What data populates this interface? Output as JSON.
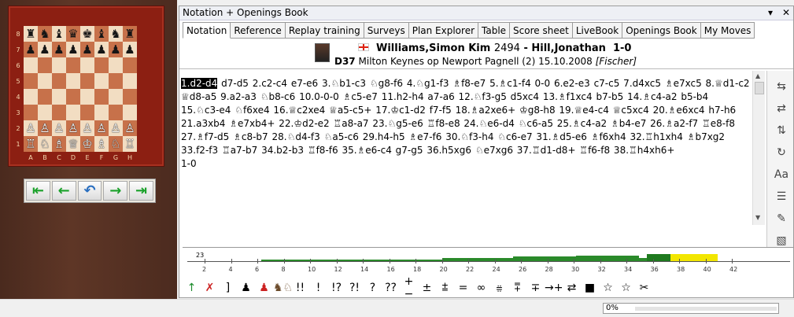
{
  "board": {
    "ranks": [
      "8",
      "7",
      "6",
      "5",
      "4",
      "3",
      "2",
      "1"
    ],
    "files": [
      "A",
      "B",
      "C",
      "D",
      "E",
      "F",
      "G",
      "H"
    ],
    "position": [
      [
        "♜",
        "♞",
        "♝",
        "♛",
        "♚",
        "♝",
        "♞",
        "♜"
      ],
      [
        "♟",
        "♟",
        "♟",
        "♟",
        "♟",
        "♟",
        "♟",
        "♟"
      ],
      [
        "",
        "",
        "",
        "",
        "",
        "",
        "",
        ""
      ],
      [
        "",
        "",
        "",
        "",
        "",
        "",
        "",
        ""
      ],
      [
        "",
        "",
        "",
        "",
        "",
        "",
        "",
        ""
      ],
      [
        "",
        "",
        "",
        "",
        "",
        "",
        "",
        ""
      ],
      [
        "♙",
        "♙",
        "♙",
        "♙",
        "♙",
        "♙",
        "♙",
        "♙"
      ],
      [
        "♖",
        "♘",
        "♗",
        "♕",
        "♔",
        "♗",
        "♘",
        "♖"
      ]
    ]
  },
  "nav": {
    "buttons": [
      "start-icon",
      "back-icon",
      "undo-icon",
      "forward-icon",
      "end-icon"
    ],
    "glyphs": [
      "⇤",
      "←",
      "↶",
      "→",
      "⇥"
    ]
  },
  "window": {
    "title": "Notation + Openings Book",
    "pin": "▾",
    "close": "✕"
  },
  "tabs": [
    "Notation",
    "Reference",
    "Replay training",
    "Surveys",
    "Plan Explorer",
    "Table",
    "Score sheet",
    "LiveBook",
    "Openings Book",
    "My Moves"
  ],
  "header": {
    "white": "Williams,Simon Kim",
    "white_elo": "2494",
    "sep": " - ",
    "black": "Hill,Jonathan",
    "result": "1-0",
    "eco": "D37",
    "event": "Milton Keynes op Newport Pagnell (2) 15.10.2008",
    "annotator": "[Fischer]"
  },
  "notation": {
    "current_move": "1.d2-d4",
    "moves": " d7-d5 2.c2-c4 e7-e6 3.♘b1-c3 ♘g8-f6 4.♘g1-f3 ♗f8-e7 5.♗c1-f4 0-0 6.e2-e3 c7-c5 7.d4xc5 ♗e7xc5 8.♕d1-c2 ♕d8-a5 9.a2-a3 ♘b8-c6 10.0-0-0 ♗c5-e7 11.h2-h4 a7-a6 12.♘f3-g5 d5xc4 13.♗f1xc4 b7-b5 14.♗c4-a2 b5-b4 15.♘c3-e4 ♘f6xe4 16.♕c2xe4 ♕a5-c5+ 17.♔c1-d2 f7-f5 18.♗a2xe6+ ♔g8-h8 19.♕e4-c4 ♕c5xc4 20.♗e6xc4 h7-h6 21.a3xb4 ♗e7xb4+ 22.♔d2-e2 ♖a8-a7 23.♘g5-e6 ♖f8-e8 24.♘e6-d4 ♘c6-a5 25.♗c4-a2 ♗b4-e7 26.♗a2-f7 ♖e8-f8 27.♗f7-d5 ♗c8-b7 28.♘d4-f3 ♘a5-c6 29.h4-h5 ♗e7-f6 30.♘f3-h4 ♘c6-e7 31.♗d5-e6 ♗f6xh4 32.♖h1xh4 ♗b7xg2 33.f2-f3 ♖a7-b7 34.b2-b3 ♖f8-f6 35.♗e6-c4 g7-g5 36.h5xg6 ♘e7xg6 37.♖d1-d8+ ♖f6-f8 38.♖h4xh6+",
    "result": "1-0"
  },
  "right_toolbar": [
    "insert-move-icon",
    "replace-move-icon",
    "promote-variation-icon",
    "delete-icon",
    "text-annotation-icon",
    "tree-icon",
    "pen-icon",
    "eraser-icon"
  ],
  "right_glyphs": [
    "⇆",
    "⇄",
    "⇅",
    "↻",
    "Aa",
    "☰",
    "✎",
    "▧"
  ],
  "graph": {
    "move_marker": "23",
    "tick_labels": [
      "2",
      "4",
      "6",
      "8",
      "10",
      "12",
      "14",
      "16",
      "18",
      "20",
      "22",
      "24",
      "26",
      "28",
      "30",
      "32",
      "34",
      "36",
      "38",
      "40",
      "42"
    ]
  },
  "annotation_toolbar": [
    "↑",
    "✗",
    "]",
    "♟",
    "♟",
    "♞♘",
    "!!",
    "!",
    "!?",
    "?!",
    "?",
    "??",
    "+−",
    "±",
    "⩲",
    "=",
    "∞",
    "⩷",
    "⩱",
    "∓",
    "→+",
    "⇄",
    "■",
    "☆",
    "☆",
    "✂"
  ],
  "status": {
    "progress": "0%"
  }
}
